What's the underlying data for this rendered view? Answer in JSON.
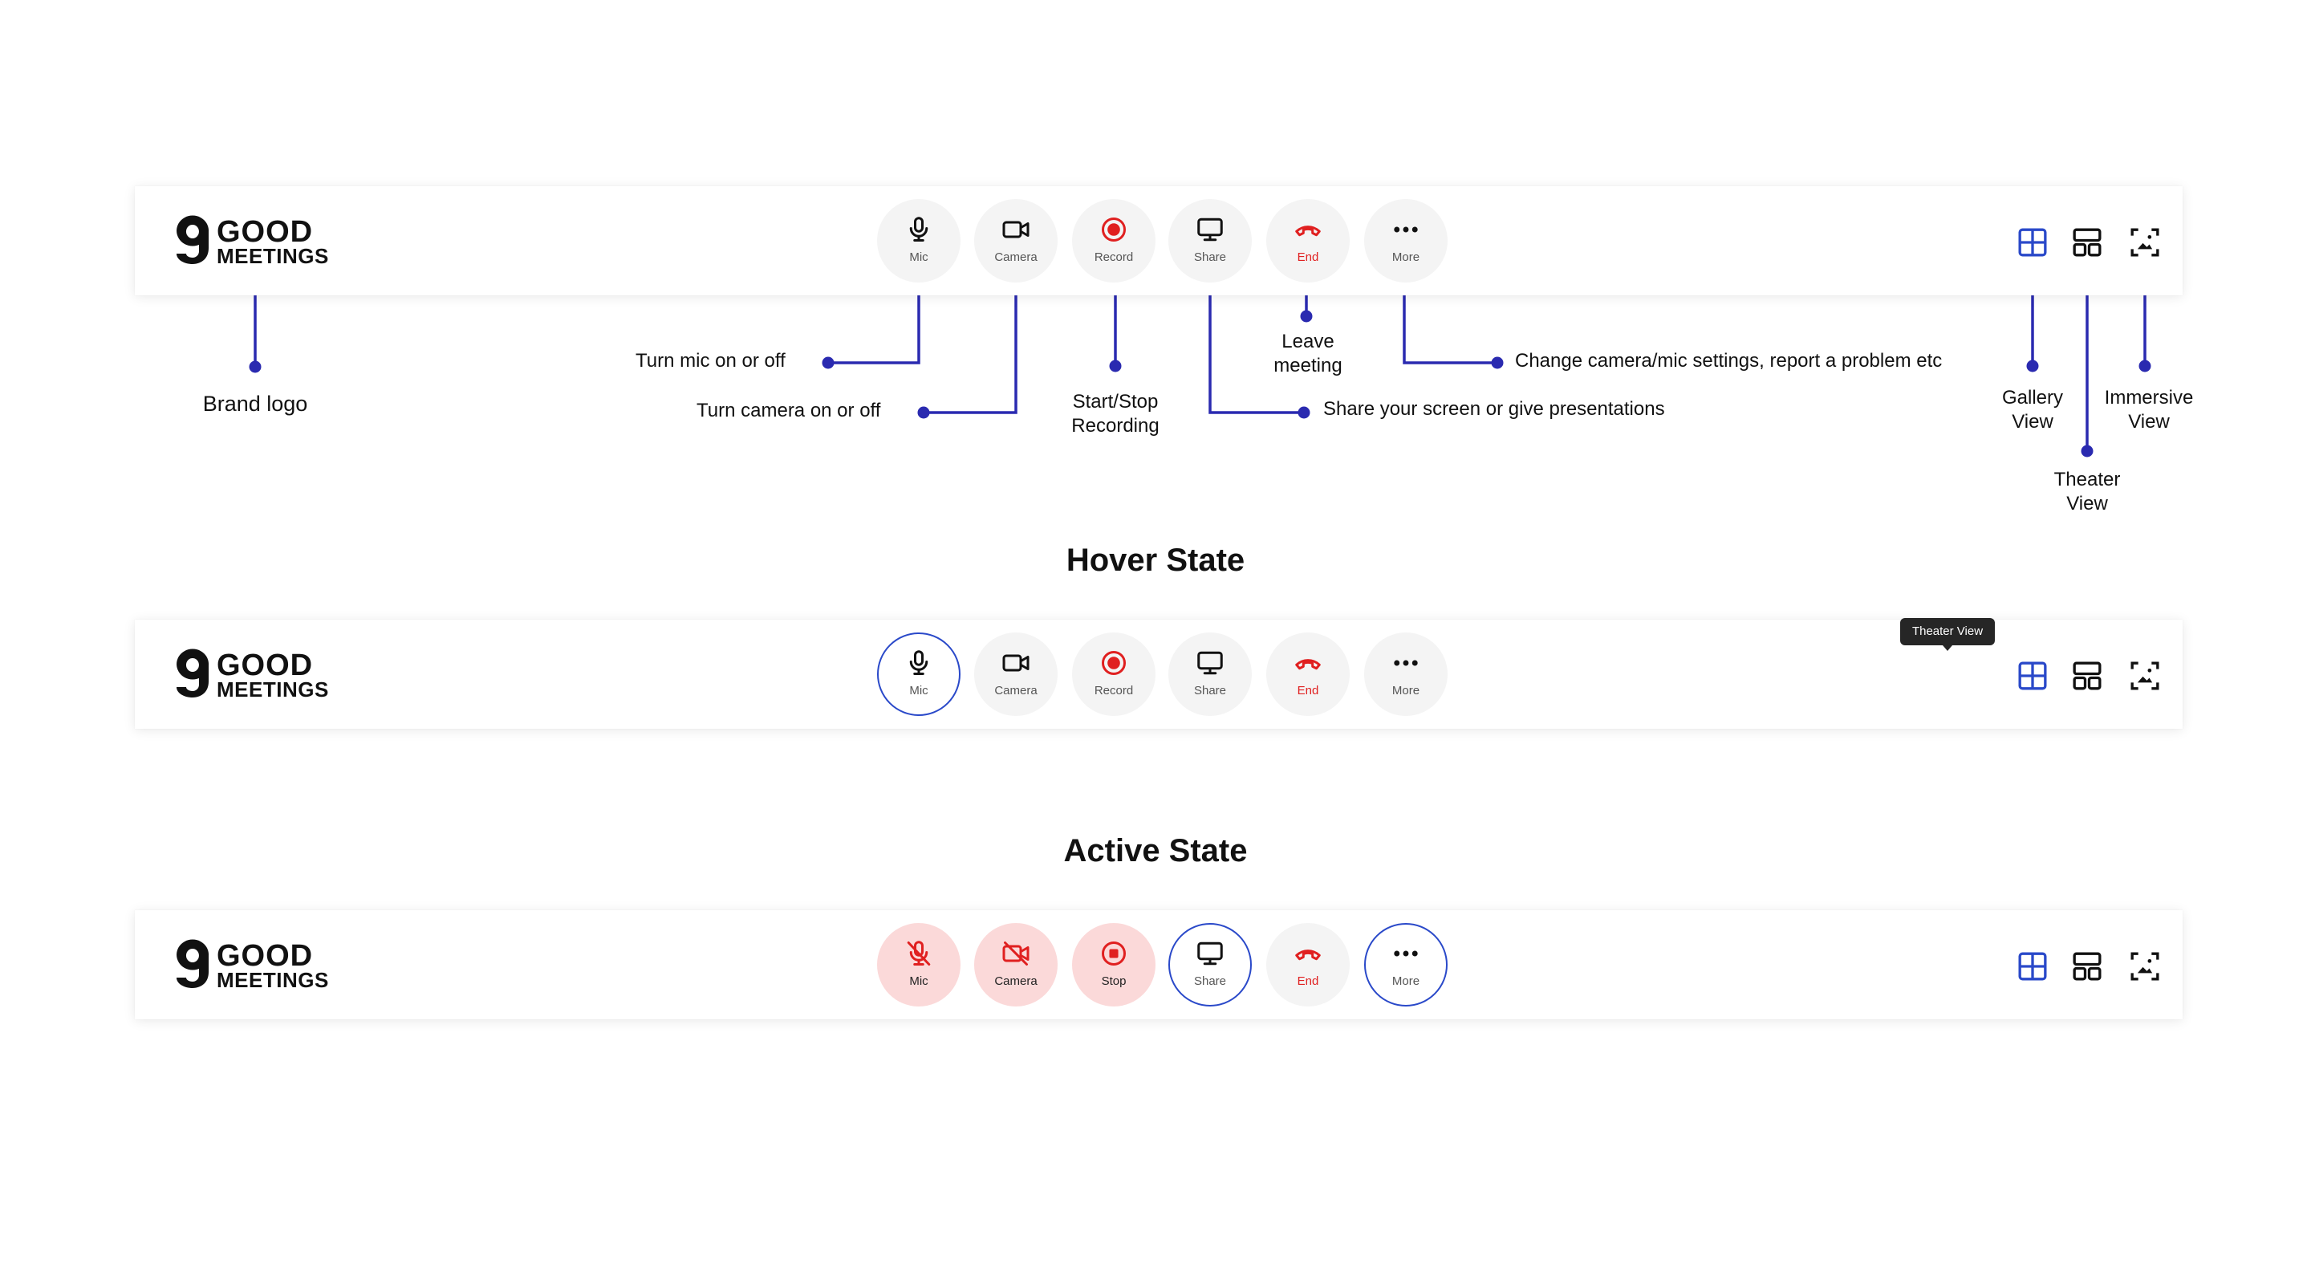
{
  "brand": {
    "line1": "GOOD",
    "line2": "MEETINGS",
    "icon": "g-logo-icon"
  },
  "controls": {
    "mic": {
      "label": "Mic",
      "icon": "microphone-icon"
    },
    "camera": {
      "label": "Camera",
      "icon": "video-camera-icon"
    },
    "record": {
      "label": "Record",
      "icon": "record-icon"
    },
    "share": {
      "label": "Share",
      "icon": "monitor-icon"
    },
    "end": {
      "label": "End",
      "icon": "phone-hangup-icon"
    },
    "more": {
      "label": "More",
      "icon": "more-dots-icon"
    },
    "stop": {
      "label": "Stop",
      "icon": "stop-record-icon"
    }
  },
  "views": {
    "gallery": {
      "icon": "gallery-view-icon"
    },
    "theater": {
      "icon": "theater-view-icon"
    },
    "immersive": {
      "icon": "immersive-view-icon"
    }
  },
  "annotations": {
    "brand_logo": "Brand logo",
    "mic": "Turn mic on or off",
    "camera": "Turn camera on or off",
    "record_line1": "Start/Stop",
    "record_line2": "Recording",
    "end_line1": "Leave",
    "end_line2": "meeting",
    "more": "Change camera/mic settings, report a problem etc",
    "share": "Share your screen or give presentations",
    "gallery_line1": "Gallery",
    "gallery_line2": "View",
    "immersive_line1": "Immersive",
    "immersive_line2": "View",
    "theater_line1": "Theater",
    "theater_line2": "View"
  },
  "sections": {
    "hover": "Hover State",
    "active": "Active State"
  },
  "tooltip": "Theater View",
  "colors": {
    "accent": "#2a49c9",
    "connector": "#2a2ab0",
    "danger": "#e02020",
    "danger_bg": "#fbd9d9",
    "button_bg": "#f4f4f4"
  }
}
